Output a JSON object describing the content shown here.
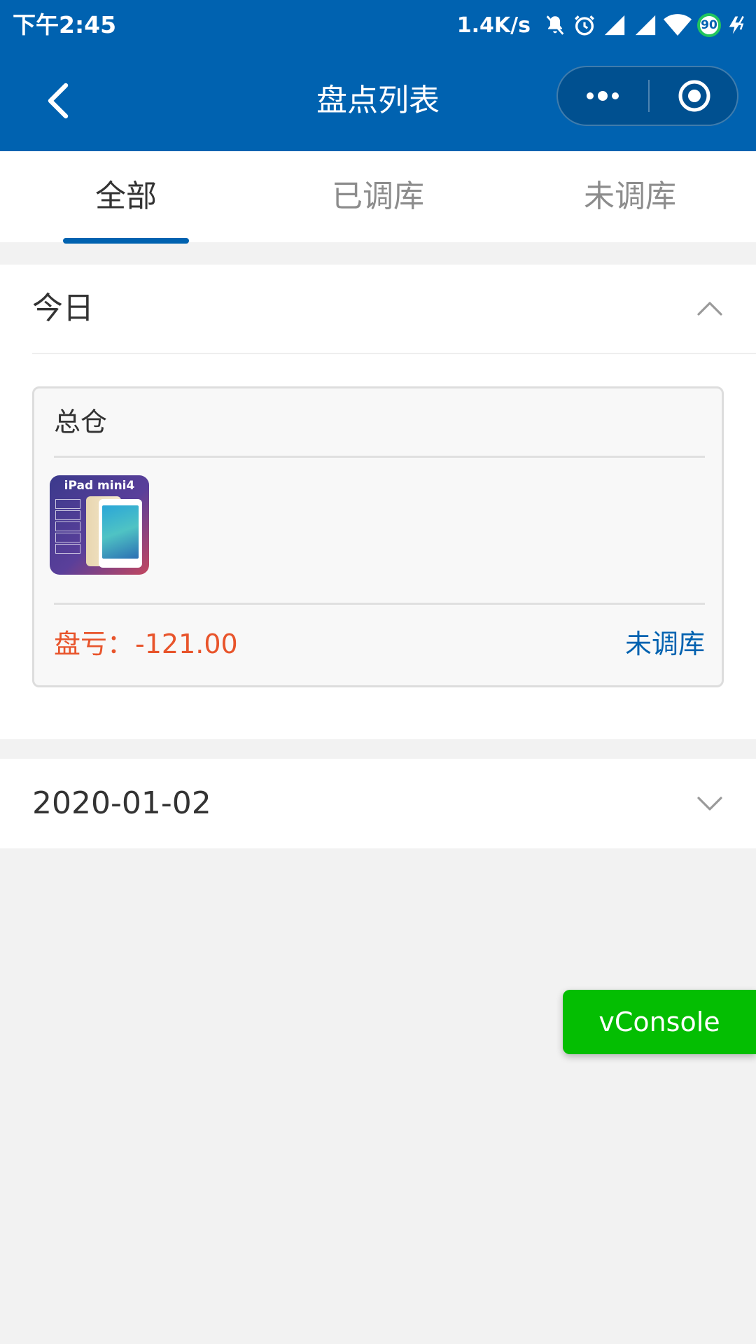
{
  "status_bar": {
    "time": "下午2:45",
    "net_speed": "1.4K/s",
    "battery": "90",
    "icons": [
      "bell-muted-icon",
      "alarm-icon",
      "signal-icon",
      "signal-icon",
      "wifi-icon",
      "battery-icon",
      "charging-icon"
    ]
  },
  "nav": {
    "title": "盘点列表",
    "back_icon": "chevron-left-icon",
    "more_icon": "more-dots-icon",
    "close_icon": "target-circle-icon"
  },
  "tabs": [
    {
      "label": "全部",
      "active": true
    },
    {
      "label": "已调库",
      "active": false
    },
    {
      "label": "未调库",
      "active": false
    }
  ],
  "sections": {
    "today": {
      "title": "今日",
      "expanded": true,
      "card": {
        "warehouse": "总仓",
        "product_image": {
          "title": "iPad mini4",
          "bullets": [
            "保修两年",
            "原装正品",
            "30天包换",
            "送钢化膜",
            "花呗分期"
          ]
        },
        "loss_label": "盘亏：",
        "loss_value": "-121.00",
        "status": "未调库"
      }
    },
    "date_group": {
      "title": "2020-01-02",
      "expanded": false
    }
  },
  "vconsole": {
    "label": "vConsole"
  },
  "colors": {
    "primary": "#0062b0",
    "loss": "#e8542b",
    "vconsole": "#04be02",
    "background": "#f2f2f2"
  }
}
